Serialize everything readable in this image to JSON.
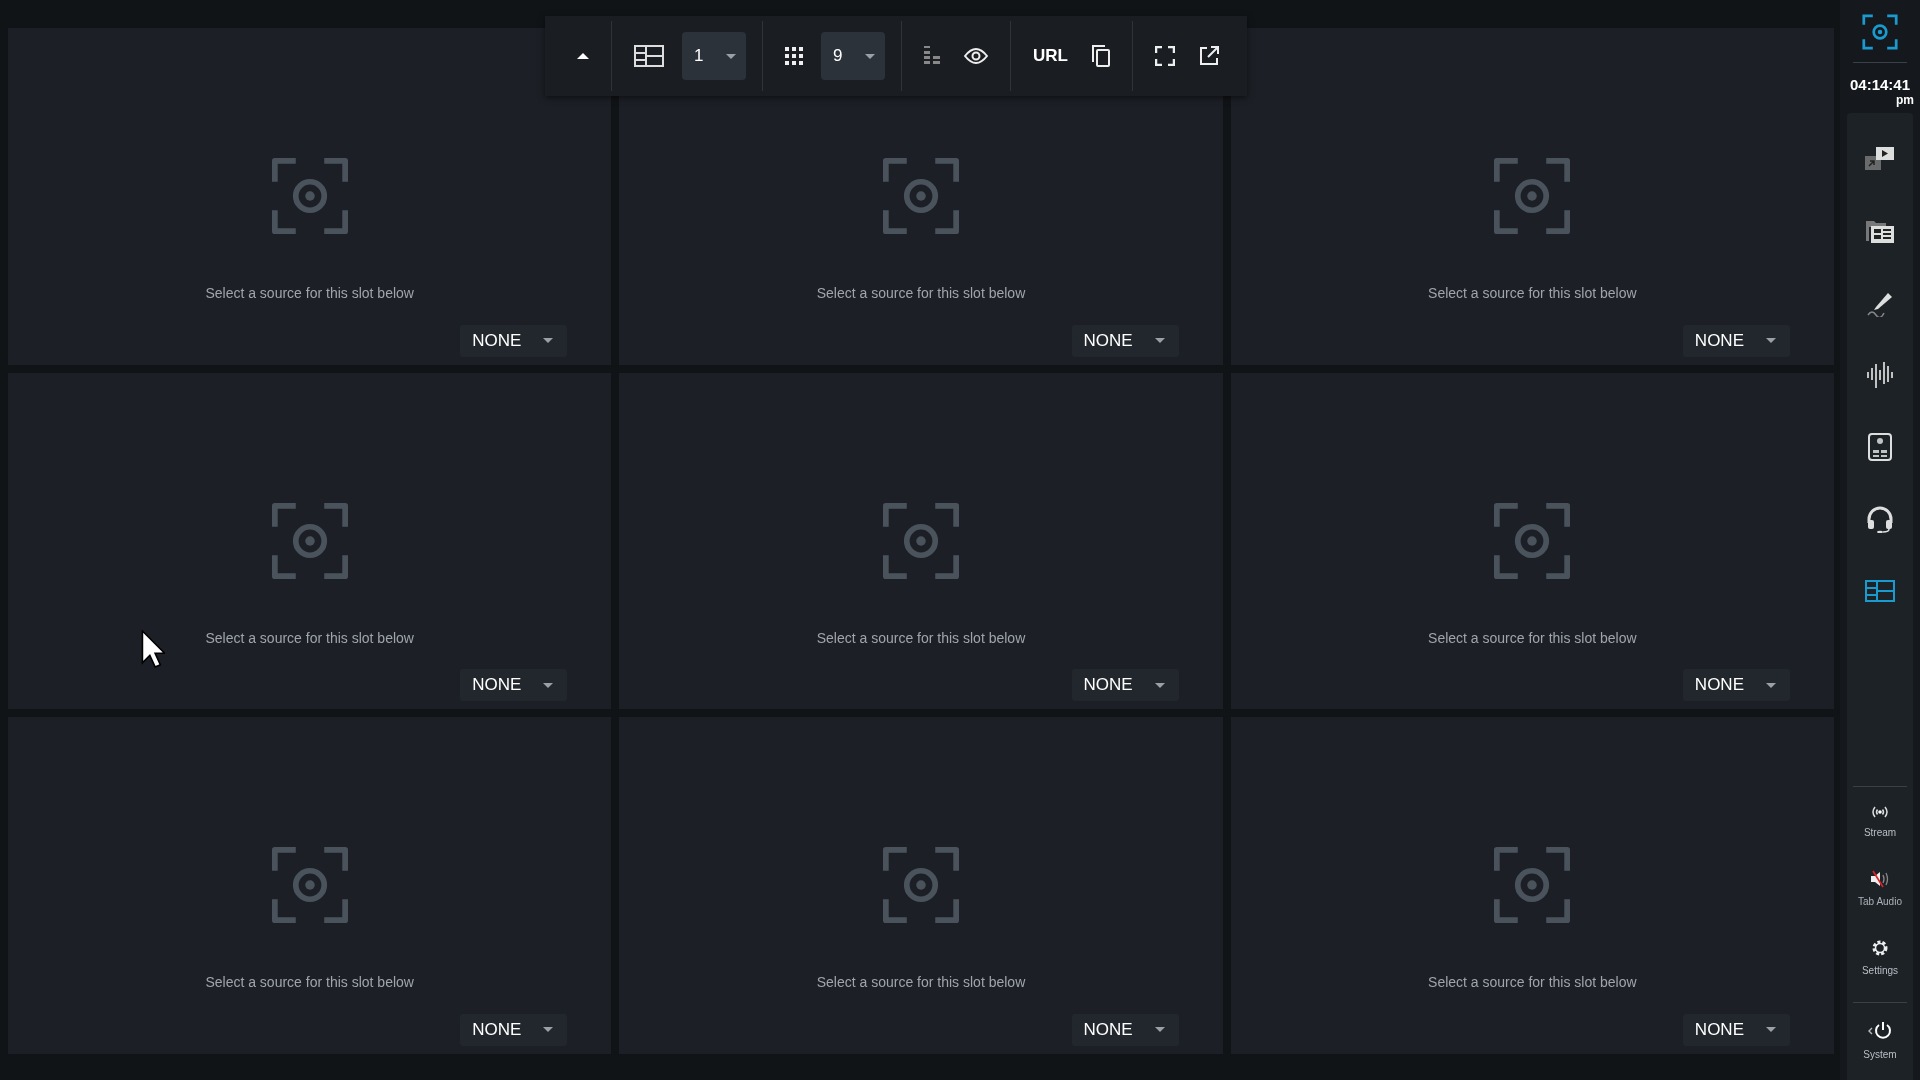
{
  "toolbar": {
    "layout_value": "1",
    "slots_value": "9",
    "url_label": "URL"
  },
  "slots": [
    {
      "message": "Select a source for this slot below",
      "source": "NONE"
    },
    {
      "message": "Select a source for this slot below",
      "source": "NONE"
    },
    {
      "message": "Select a source for this slot below",
      "source": "NONE"
    },
    {
      "message": "Select a source for this slot below",
      "source": "NONE"
    },
    {
      "message": "Select a source for this slot below",
      "source": "NONE"
    },
    {
      "message": "Select a source for this slot below",
      "source": "NONE"
    },
    {
      "message": "Select a source for this slot below",
      "source": "NONE"
    },
    {
      "message": "Select a source for this slot below",
      "source": "NONE"
    },
    {
      "message": "Select a source for this slot below",
      "source": "NONE"
    }
  ],
  "clock": {
    "time": "04:14:41",
    "period": "pm"
  },
  "sidebar": {
    "tools": [
      {
        "kind": "video",
        "selected": false
      },
      {
        "kind": "folder",
        "selected": false
      },
      {
        "kind": "pen",
        "selected": false
      },
      {
        "kind": "audio",
        "selected": false
      },
      {
        "kind": "score",
        "selected": false
      },
      {
        "kind": "headset",
        "selected": false
      },
      {
        "kind": "layout",
        "selected": true
      }
    ],
    "actions": [
      {
        "kind": "stream",
        "label": "Stream",
        "muted": false
      },
      {
        "kind": "tab-audio",
        "label": "Tab Audio",
        "muted": true
      },
      {
        "kind": "settings",
        "label": "Settings",
        "muted": false
      }
    ],
    "system": {
      "label": "System"
    }
  }
}
